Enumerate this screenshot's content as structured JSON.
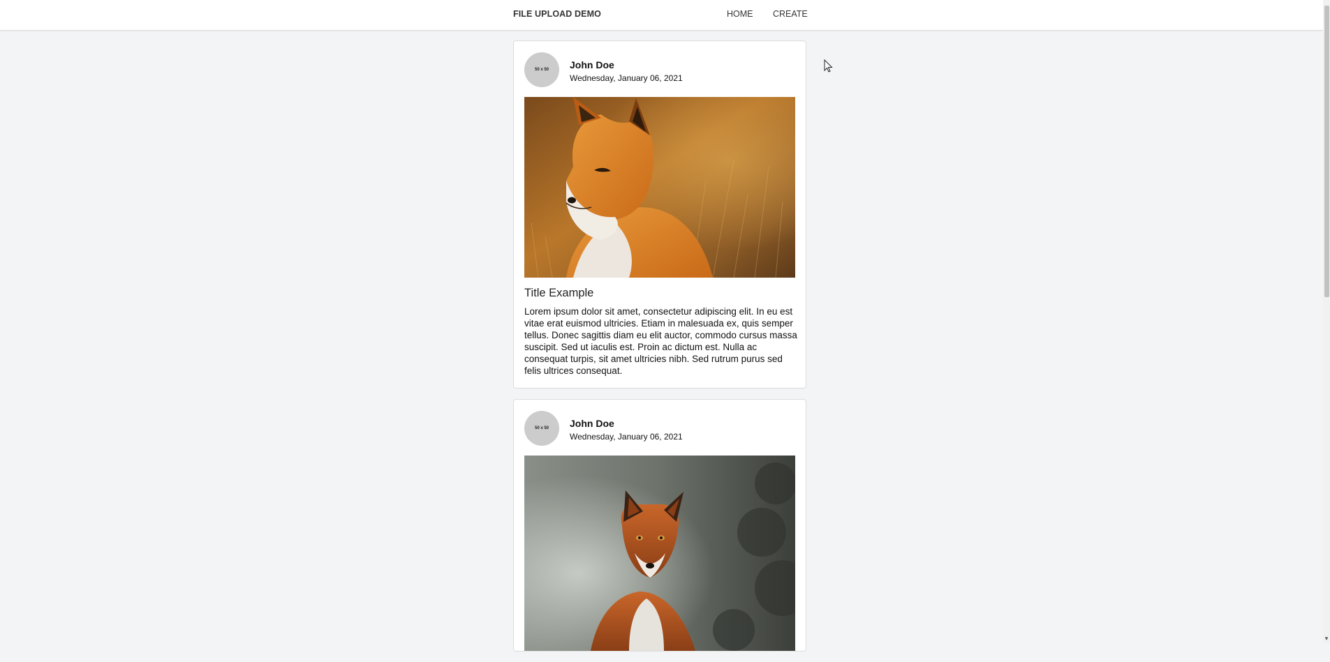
{
  "navbar": {
    "brand": "FILE UPLOAD DEMO",
    "links": [
      {
        "label": "HOME"
      },
      {
        "label": "CREATE"
      }
    ]
  },
  "posts": [
    {
      "author": "John Doe",
      "date": "Wednesday, January 06, 2021",
      "avatar_placeholder": "50 x 50",
      "image_icon": "fox-photo",
      "title": "Title Example",
      "body": "Lorem ipsum dolor sit amet, consectetur adipiscing elit. In eu est vitae erat euismod ultricies. Etiam in malesuada ex, quis semper tellus. Donec sagittis diam eu elit auctor, commodo cursus massa suscipit. Sed ut iaculis est. Proin ac dictum est. Nulla ac consequat turpis, sit amet ultricies nibh. Sed rutrum purus sed felis ultrices consequat."
    },
    {
      "author": "John Doe",
      "date": "Wednesday, January 06, 2021",
      "avatar_placeholder": "50 x 50",
      "image_icon": "fox-photo"
    }
  ],
  "colors": {
    "page_background": "#f3f4f6",
    "card_background": "#ffffff",
    "border": "#dcdcdc",
    "avatar": "#cccccc"
  }
}
